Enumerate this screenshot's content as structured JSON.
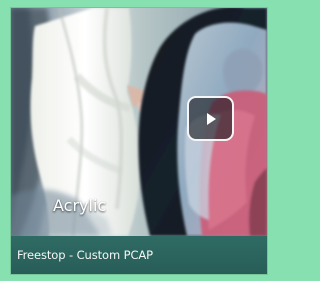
{
  "card": {
    "overlay_label": "Acrylic",
    "caption": "Freestop - Custom PCAP"
  },
  "media": {
    "play_icon": "play-icon"
  },
  "colors": {
    "page_background": "#87e0b0",
    "caption_background": "#2c655f",
    "text": "#ffffff"
  }
}
